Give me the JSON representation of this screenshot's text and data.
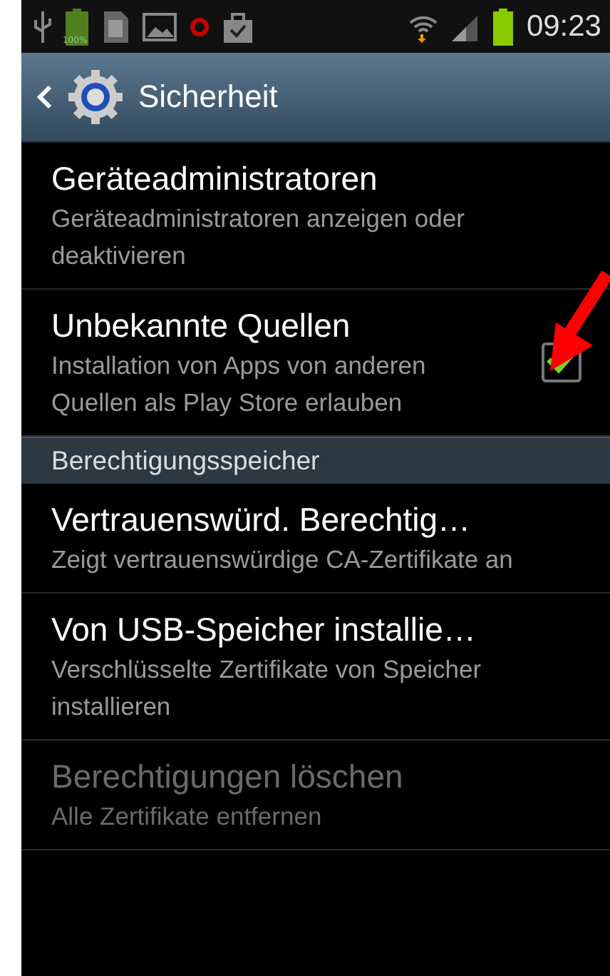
{
  "status_bar": {
    "battery_label": "100%",
    "time": "09:23"
  },
  "action_bar": {
    "title": "Sicherheit"
  },
  "items": [
    {
      "kind": "plain",
      "title": "Geräteadministratoren",
      "summary": "Geräteadministratoren anzeigen oder deaktivieren",
      "disabled": false
    },
    {
      "kind": "checkbox",
      "title": "Unbekannte Quellen",
      "summary": "Installation von Apps von anderen Quellen als Play Store erlauben",
      "disabled": false,
      "checked": true
    },
    {
      "kind": "header",
      "title": "Berechtigungsspeicher"
    },
    {
      "kind": "plain",
      "title": "Vertrauenswürd. Berechtig…",
      "summary": "Zeigt vertrauenswürdige CA-Zertifikate an",
      "disabled": false
    },
    {
      "kind": "plain",
      "title": "Von USB-Speicher installie…",
      "summary": "Verschlüsselte Zertifikate von Speicher installieren",
      "disabled": false
    },
    {
      "kind": "plain",
      "title": "Berechtigungen löschen",
      "summary": "Alle Zertifikate entfernen",
      "disabled": true
    }
  ]
}
